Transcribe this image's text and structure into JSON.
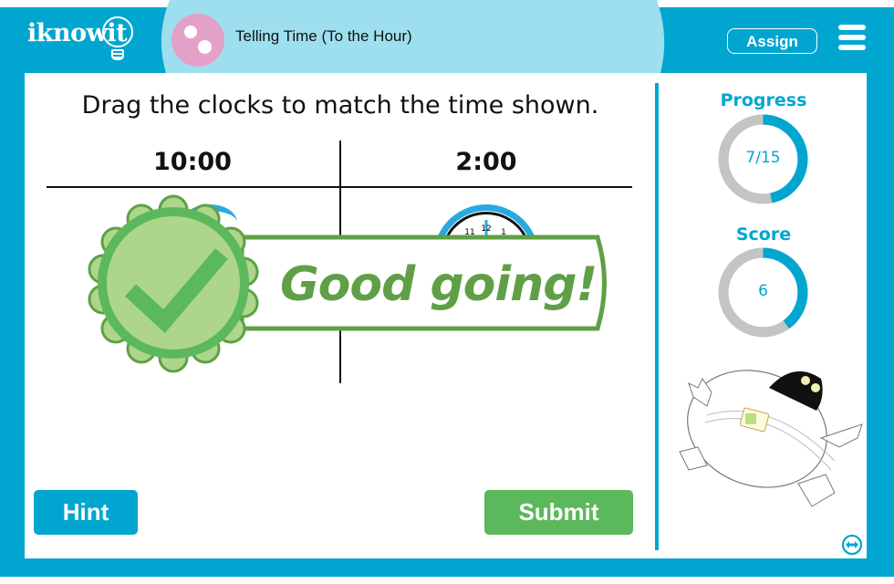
{
  "header": {
    "logo_text": "iknowit",
    "topic_title": "Telling Time (To the Hour)",
    "topic_icon": "two-dots-icon",
    "assign_label": "Assign",
    "menu_icon": "hamburger-menu-icon"
  },
  "question": {
    "instruction": "Drag the clocks to match the time shown.",
    "columns": [
      "10:00",
      "2:00"
    ],
    "feedback": "Good going!",
    "feedback_icon": "checkmark-badge-icon"
  },
  "stats": {
    "progress_label": "Progress",
    "progress_text": "7/15",
    "progress_fraction": 0.4667,
    "score_label": "Score",
    "score_text": "6",
    "score_fraction": 0.4
  },
  "buttons": {
    "hint": "Hint",
    "submit": "Submit"
  },
  "colors": {
    "brand": "#00a6cf",
    "tab": "#9ddfee",
    "success": "#5cb85c",
    "feedback_green": "#5fa046",
    "ring_track": "#c4c4c4",
    "topic_pink": "#e4a1c8"
  }
}
